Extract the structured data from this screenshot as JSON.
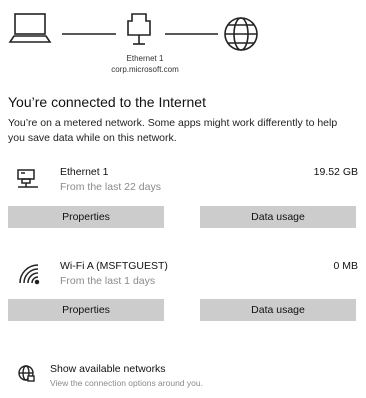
{
  "diagram": {
    "adapter_name": "Ethernet 1",
    "domain": "corp.microsoft.com",
    "icons": [
      "laptop-icon",
      "ethernet-port-icon",
      "globe-icon"
    ]
  },
  "status": {
    "title": "You’re connected to the Internet",
    "description": "You’re on a metered network. Some apps might work differently to help you save data while on this network."
  },
  "networks": [
    {
      "name": "Ethernet 1",
      "period": "From the last 22 days",
      "usage": "19.52 GB",
      "icon": "ethernet-icon",
      "properties_label": "Properties",
      "data_usage_label": "Data usage"
    },
    {
      "name": "Wi-Fi A (MSFTGUEST)",
      "period": "From the last 1 days",
      "usage": "0 MB",
      "icon": "wifi-icon",
      "properties_label": "Properties",
      "data_usage_label": "Data usage"
    }
  ],
  "show_networks": {
    "label": "Show available networks",
    "sublabel": "View the connection options around you.",
    "icon": "globe-network-icon"
  },
  "colors": {
    "button_bg": "#cccccc",
    "secondary_text": "#8a8a8a"
  }
}
